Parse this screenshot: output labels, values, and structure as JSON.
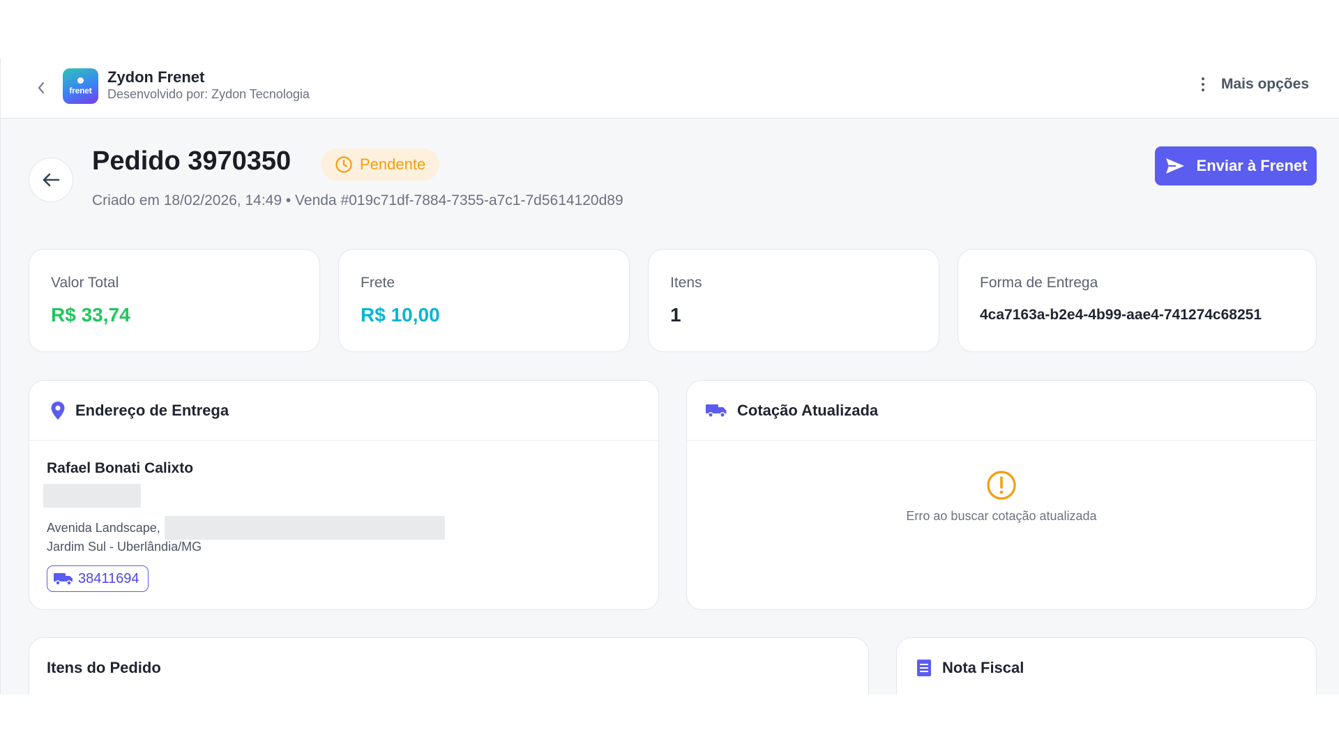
{
  "app": {
    "name": "Zydon Frenet",
    "developer": "Desenvolvido por: Zydon Tecnologia",
    "logo_text": "frenet",
    "more_options": "Mais opções"
  },
  "order": {
    "title": "Pedido 3970350",
    "status": "Pendente",
    "subtitle": "Criado em 18/02/2026, 14:49 • Venda #019c71df-7884-7355-a7c1-7d5614120d89",
    "send_button": "Enviar à Frenet"
  },
  "stats": [
    {
      "label": "Valor Total",
      "value": "R$ 33,74",
      "color": "#22c55e"
    },
    {
      "label": "Frete",
      "value": "R$ 10,00",
      "color": "#06b6d4"
    },
    {
      "label": "Itens",
      "value": "1",
      "color": "#1f2430"
    },
    {
      "label": "Forma de Entrega",
      "value": "4ca7163a-b2e4-4b99-aae4-741274c68251",
      "color": "#1f2430"
    }
  ],
  "delivery": {
    "title": "Endereço de Entrega",
    "recipient": "Rafael Bonati Calixto",
    "street": "Avenida Landscape,",
    "district": "Jardim Sul - Uberlândia/MG",
    "cep": "38411694"
  },
  "quote": {
    "title": "Cotação Atualizada",
    "error": "Erro ao buscar cotação atualizada"
  },
  "items_panel": {
    "title": "Itens do Pedido"
  },
  "invoice_panel": {
    "title": "Nota Fiscal"
  },
  "colors": {
    "accent": "#5b5cf0",
    "pending": "#f59e0b",
    "pending_bg": "#fdf1de"
  }
}
